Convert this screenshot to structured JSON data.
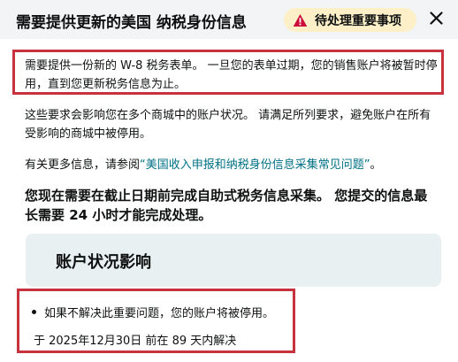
{
  "header": {
    "title": "需要提供更新的美国 纳税身份信息",
    "badge_label": "待处理重要事项",
    "badge_icon": "warning-triangle-icon",
    "close_icon": "close-icon"
  },
  "content": {
    "notice": "需要提供一份新的 W-8 税务表单。 一旦您的表单过期，您的销售账户将被暂时停用，直到您更新税务信息为止。",
    "requirements": "这些要求会影响您在多个商城中的账户状况。 请满足所列要求，避免账户在所有受影响的商城中被停用。",
    "more_info_prefix": "有关更多信息，请参阅",
    "more_info_link": "“美国收入申报和纳税身份信息采集常见问题”",
    "more_info_suffix": "。",
    "bold_notice": "您现在需要在截止日期前完成自助式税务信息采集。 您提交的信息最长需要 24 小时才能完成处理。"
  },
  "impact": {
    "title": "账户状况影响",
    "bullet": "如果不解决此重要问题，您的账户将被停用。",
    "deadline": "于 2025年12月30日 前在 89 天内解决"
  },
  "colors": {
    "accent_red": "#c6333f",
    "warning_red": "#cc0c39",
    "badge_bg": "#fdf0c9",
    "link": "#007185"
  }
}
